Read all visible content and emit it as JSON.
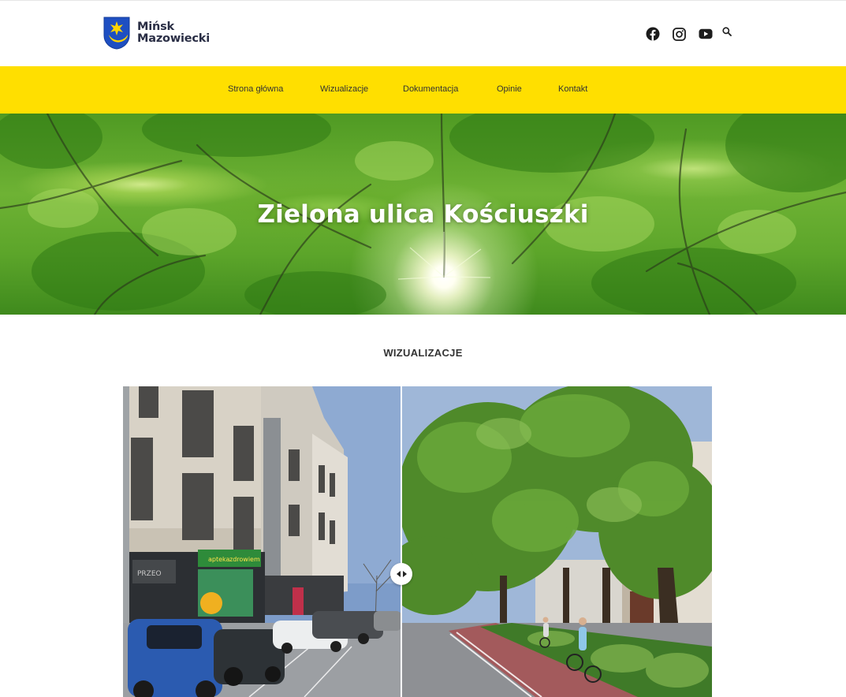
{
  "brand": {
    "line1": "Mińsk",
    "line2": "Mazowiecki",
    "crest_colors": {
      "shield": "#1e4fc2",
      "star": "#ffd400",
      "moon": "#ffd400"
    }
  },
  "social": [
    {
      "name": "facebook-icon"
    },
    {
      "name": "instagram-icon"
    },
    {
      "name": "youtube-icon"
    },
    {
      "name": "search-icon"
    }
  ],
  "nav": {
    "items": [
      {
        "label": "Strona główna"
      },
      {
        "label": "Wizualizacje"
      },
      {
        "label": "Dokumentacja"
      },
      {
        "label": "Opinie"
      },
      {
        "label": "Kontakt"
      }
    ],
    "background": "#ffdf00"
  },
  "hero": {
    "title": "Zielona ulica Kościuszki"
  },
  "section": {
    "title": "WIZUALIZACJE"
  },
  "comparison": {
    "before_caption": "",
    "after_caption": "",
    "split_fraction": 0.473,
    "store_sign_before": "apteka ",
    "store_sign_before_2": "zdrowiem",
    "plate_before": "",
    "crest_before": "PRZEO"
  },
  "colors": {
    "accent": "#ffdf00",
    "text": "#333333"
  }
}
